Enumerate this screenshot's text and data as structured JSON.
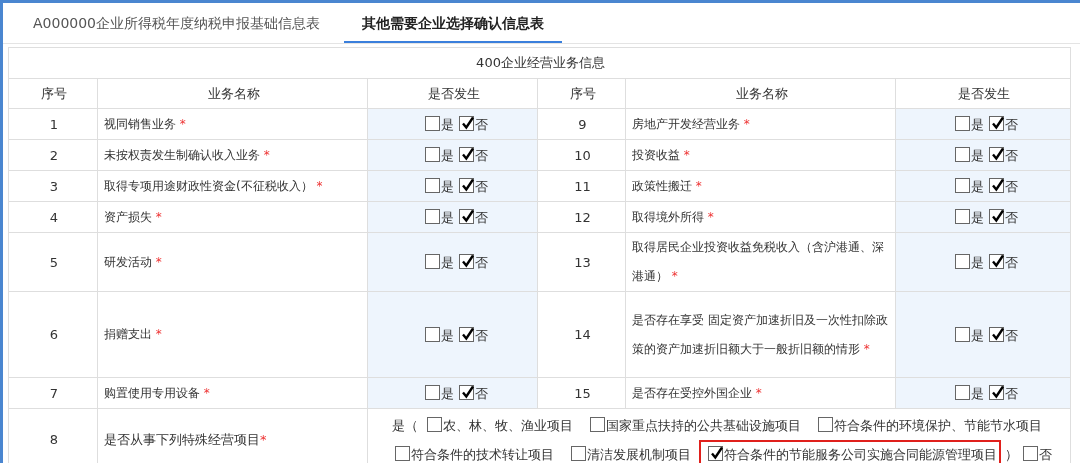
{
  "tabs": [
    {
      "label": "A000000企业所得税年度纳税申报基础信息表",
      "selected": false
    },
    {
      "label": "其他需要企业选择确认信息表",
      "selected": true
    }
  ],
  "table": {
    "title": "400企业经营业务信息",
    "columns": [
      "序号",
      "业务名称",
      "是否发生",
      "序号",
      "业务名称",
      "是否发生"
    ],
    "rows": [
      {
        "left": {
          "seq": "1",
          "name": "视同销售业务",
          "mark": "*",
          "options": [
            {
              "label": "是",
              "checked": false
            },
            {
              "label": "否",
              "checked": true
            }
          ]
        },
        "right": {
          "seq": "9",
          "name": "房地产开发经营业务",
          "mark": "*",
          "options": [
            {
              "label": "是",
              "checked": false
            },
            {
              "label": "否",
              "checked": true
            }
          ]
        }
      },
      {
        "left": {
          "seq": "2",
          "name": "未按权责发生制确认收入业务",
          "mark": "*",
          "options": [
            {
              "label": "是",
              "checked": false
            },
            {
              "label": "否",
              "checked": true
            }
          ]
        },
        "right": {
          "seq": "10",
          "name": "投资收益",
          "mark": "*",
          "options": [
            {
              "label": "是",
              "checked": false
            },
            {
              "label": "否",
              "checked": true
            }
          ]
        }
      },
      {
        "left": {
          "seq": "3",
          "name": "取得专项用途财政性资金(不征税收入）",
          "mark": "*",
          "options": [
            {
              "label": "是",
              "checked": false
            },
            {
              "label": "否",
              "checked": true
            }
          ]
        },
        "right": {
          "seq": "11",
          "name": "政策性搬迁",
          "mark": "*",
          "options": [
            {
              "label": "是",
              "checked": false
            },
            {
              "label": "否",
              "checked": true
            }
          ]
        }
      },
      {
        "left": {
          "seq": "4",
          "name": "资产损失",
          "mark": "*",
          "options": [
            {
              "label": "是",
              "checked": false
            },
            {
              "label": "否",
              "checked": true
            }
          ]
        },
        "right": {
          "seq": "12",
          "name": "取得境外所得",
          "mark": "*",
          "options": [
            {
              "label": "是",
              "checked": false
            },
            {
              "label": "否",
              "checked": true
            }
          ]
        }
      },
      {
        "left": {
          "seq": "5",
          "name": "研发活动",
          "mark": "*",
          "options": [
            {
              "label": "是",
              "checked": false
            },
            {
              "label": "否",
              "checked": true
            }
          ]
        },
        "right": {
          "seq": "13",
          "name": "取得居民企业投资收益免税收入（含沪港通、深港通）",
          "mark": "*",
          "options": [
            {
              "label": "是",
              "checked": false
            },
            {
              "label": "否",
              "checked": true
            }
          ]
        }
      },
      {
        "left": {
          "seq": "6",
          "name": "捐赠支出",
          "mark": "*",
          "options": [
            {
              "label": "是",
              "checked": false
            },
            {
              "label": "否",
              "checked": true
            }
          ]
        },
        "right": {
          "seq": "14",
          "name": "是否存在享受 固定资产加速折旧及一次性扣除政策的资产加速折旧额大于一般折旧额的情形",
          "mark": "*",
          "options": [
            {
              "label": "是",
              "checked": false
            },
            {
              "label": "否",
              "checked": true
            }
          ]
        }
      },
      {
        "left": {
          "seq": "7",
          "name": "购置使用专用设备",
          "mark": "*",
          "options": [
            {
              "label": "是",
              "checked": false
            },
            {
              "label": "否",
              "checked": true
            }
          ]
        },
        "right": {
          "seq": "15",
          "name": "是否存在受控外国企业",
          "mark": "*",
          "options": [
            {
              "label": "是",
              "checked": false
            },
            {
              "label": "否",
              "checked": true
            }
          ]
        }
      }
    ],
    "special_row": {
      "seq": "8",
      "name": "是否从事下列特殊经营项目",
      "mark": "*",
      "yes_label": "是（",
      "options": [
        {
          "label": "农、林、牧、渔业项目",
          "checked": false,
          "highlighted": false
        },
        {
          "label": "国家重点扶持的公共基础设施项目",
          "checked": false,
          "highlighted": false
        },
        {
          "label": "符合条件的环境保护、节能节水项目",
          "checked": false,
          "highlighted": false
        },
        {
          "label": "符合条件的技术转让项目",
          "checked": false,
          "highlighted": false
        },
        {
          "label": "清洁发展机制项目",
          "checked": false,
          "highlighted": false
        },
        {
          "label": "符合条件的节能服务公司实施合同能源管理项目",
          "checked": true,
          "highlighted": true
        }
      ],
      "close_label": "）",
      "no_option": {
        "label": "否",
        "checked": false
      }
    }
  }
}
